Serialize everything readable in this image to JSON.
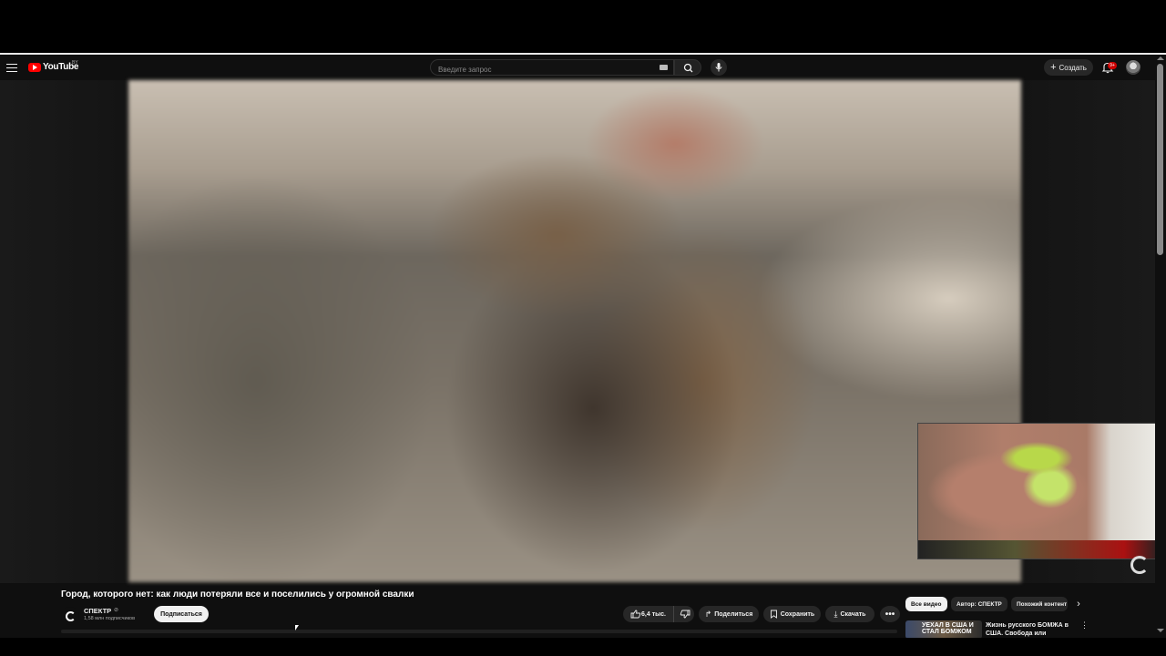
{
  "header": {
    "logo_text": "YouTube",
    "logo_region": "BY",
    "search_placeholder": "Введите запрос",
    "create_label": "Создать",
    "notifications_count": "9+"
  },
  "video": {
    "title": "Город, которого нет: как люди потеряли все и поселились у огромной свалки",
    "channel": {
      "name": "СПЕКТР",
      "verified_mark": "⊘",
      "subscribers": "1,58 млн подписчиков",
      "subscribe_label": "Подписаться"
    },
    "actions": {
      "likes": "6,4 тыс.",
      "share_label": "Поделиться",
      "save_label": "Сохранить",
      "download_label": "Скачать",
      "more_label": "•••"
    }
  },
  "sidebar": {
    "chips": [
      "Все видео",
      "Автор: СПЕКТР",
      "Похожий контент"
    ],
    "active_chip": "Все видео",
    "recommendations": [
      {
        "thumb_text": "УЕХАЛ В США И СТАЛ БОМЖОМ",
        "title": "Жизнь русского БОМЖА в США. Свобода или"
      }
    ]
  },
  "icons": {
    "menu": "menu-icon",
    "search": "search-icon",
    "mic": "mic-icon",
    "bell": "bell-icon",
    "like": "thumb-up-icon",
    "dislike": "thumb-down-icon",
    "share": "share-icon",
    "save": "bookmark-icon",
    "download": "download-icon"
  },
  "colors": {
    "brand_red": "#ff0000",
    "background": "#0f0f0f",
    "pill": "#272727"
  }
}
